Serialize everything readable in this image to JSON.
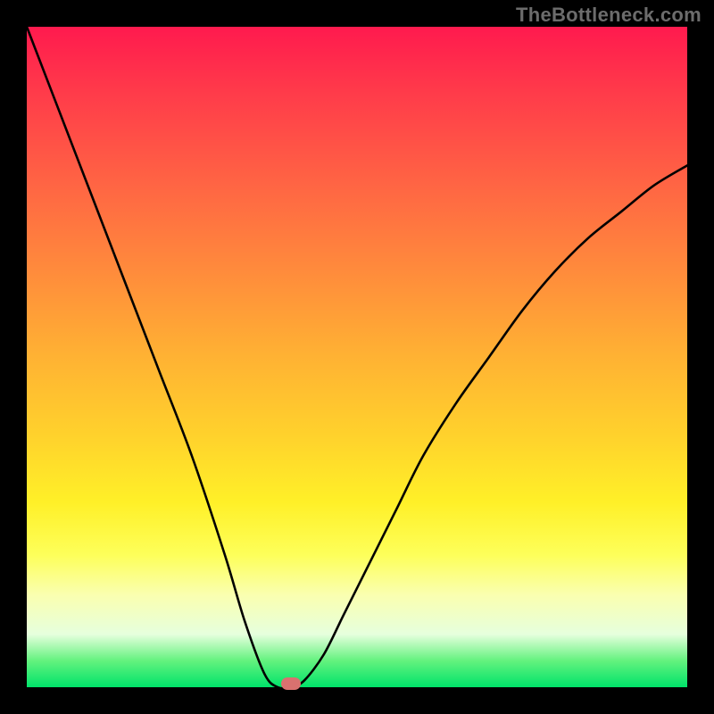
{
  "watermark": "TheBottleneck.com",
  "chart_data": {
    "type": "line",
    "title": "",
    "xlabel": "",
    "ylabel": "",
    "xlim": [
      0,
      1
    ],
    "ylim": [
      0,
      1
    ],
    "background_gradient": [
      "#ff1a4e",
      "#ff6843",
      "#ffb233",
      "#fff028",
      "#faffb0",
      "#00e36a"
    ],
    "series": [
      {
        "name": "bottleneck-curve",
        "x": [
          0.0,
          0.05,
          0.1,
          0.15,
          0.2,
          0.25,
          0.3,
          0.33,
          0.36,
          0.38,
          0.4,
          0.42,
          0.45,
          0.48,
          0.52,
          0.56,
          0.6,
          0.65,
          0.7,
          0.75,
          0.8,
          0.85,
          0.9,
          0.95,
          1.0
        ],
        "y": [
          1.0,
          0.87,
          0.74,
          0.61,
          0.48,
          0.35,
          0.2,
          0.1,
          0.02,
          0.0,
          0.0,
          0.01,
          0.05,
          0.11,
          0.19,
          0.27,
          0.35,
          0.43,
          0.5,
          0.57,
          0.63,
          0.68,
          0.72,
          0.76,
          0.79
        ]
      }
    ],
    "marker": {
      "x": 0.4,
      "y": 0.005,
      "color": "#d9716f"
    }
  }
}
